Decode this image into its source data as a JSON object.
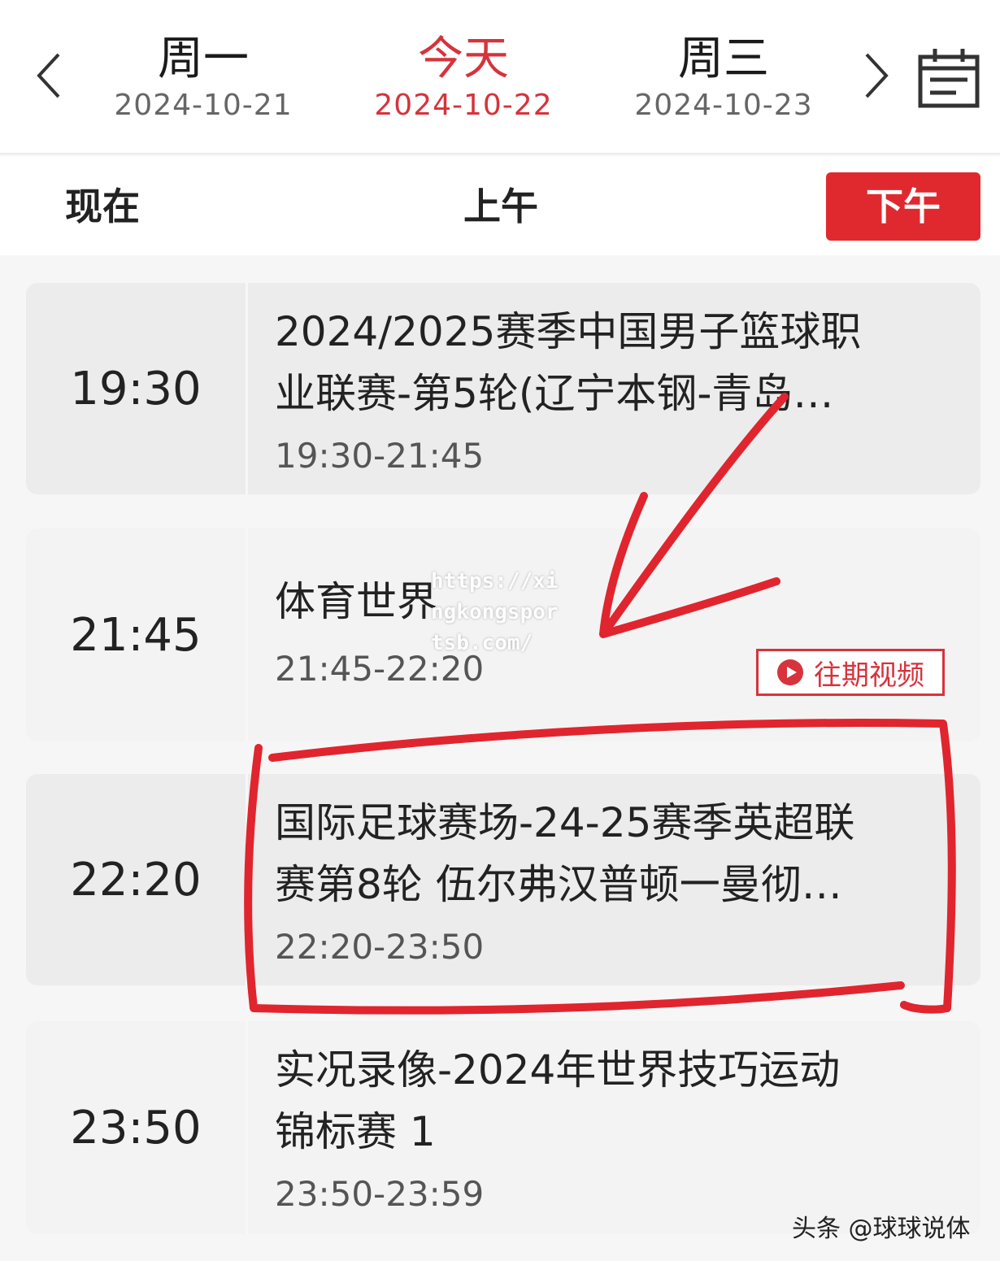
{
  "date_nav": {
    "days": [
      {
        "label": "周一",
        "date": "2024-10-21"
      },
      {
        "label": "今天",
        "date": "2024-10-22"
      },
      {
        "label": "周三",
        "date": "2024-10-23"
      }
    ],
    "icons": {
      "prev": "chevron-left-icon",
      "next": "chevron-right-icon",
      "calendar": "calendar-icon"
    },
    "accent_color": "#d6333c"
  },
  "periods": {
    "now": "现在",
    "am": "上午",
    "pm": "下午",
    "selected": "下午"
  },
  "schedule": [
    {
      "time": "19:30",
      "title_line1": "2024/2025赛季中国男子篮球职",
      "title_line2": "业联赛-第5轮(辽宁本钢-青岛…",
      "range": "19:30-21:45"
    },
    {
      "time": "21:45",
      "title_line1": "体育世界",
      "title_line2": "",
      "range": "21:45-22:20",
      "replay_label": "往期视频"
    },
    {
      "time": "22:20",
      "title_line1": "国际足球赛场-24-25赛季英超联",
      "title_line2": "赛第8轮 伍尔弗汉普顿一曼彻…",
      "range": "22:20-23:50"
    },
    {
      "time": "23:50",
      "title_line1": "实况录像-2024年世界技巧运动",
      "title_line2": "锦标赛 1",
      "range": "23:50-23:59"
    }
  ],
  "watermark": {
    "line1": "https://xi",
    "line2": "ngkongspor",
    "line3": "tsb.com/"
  },
  "source": "头条 @球球说体",
  "annotation_color": "#e0252e"
}
